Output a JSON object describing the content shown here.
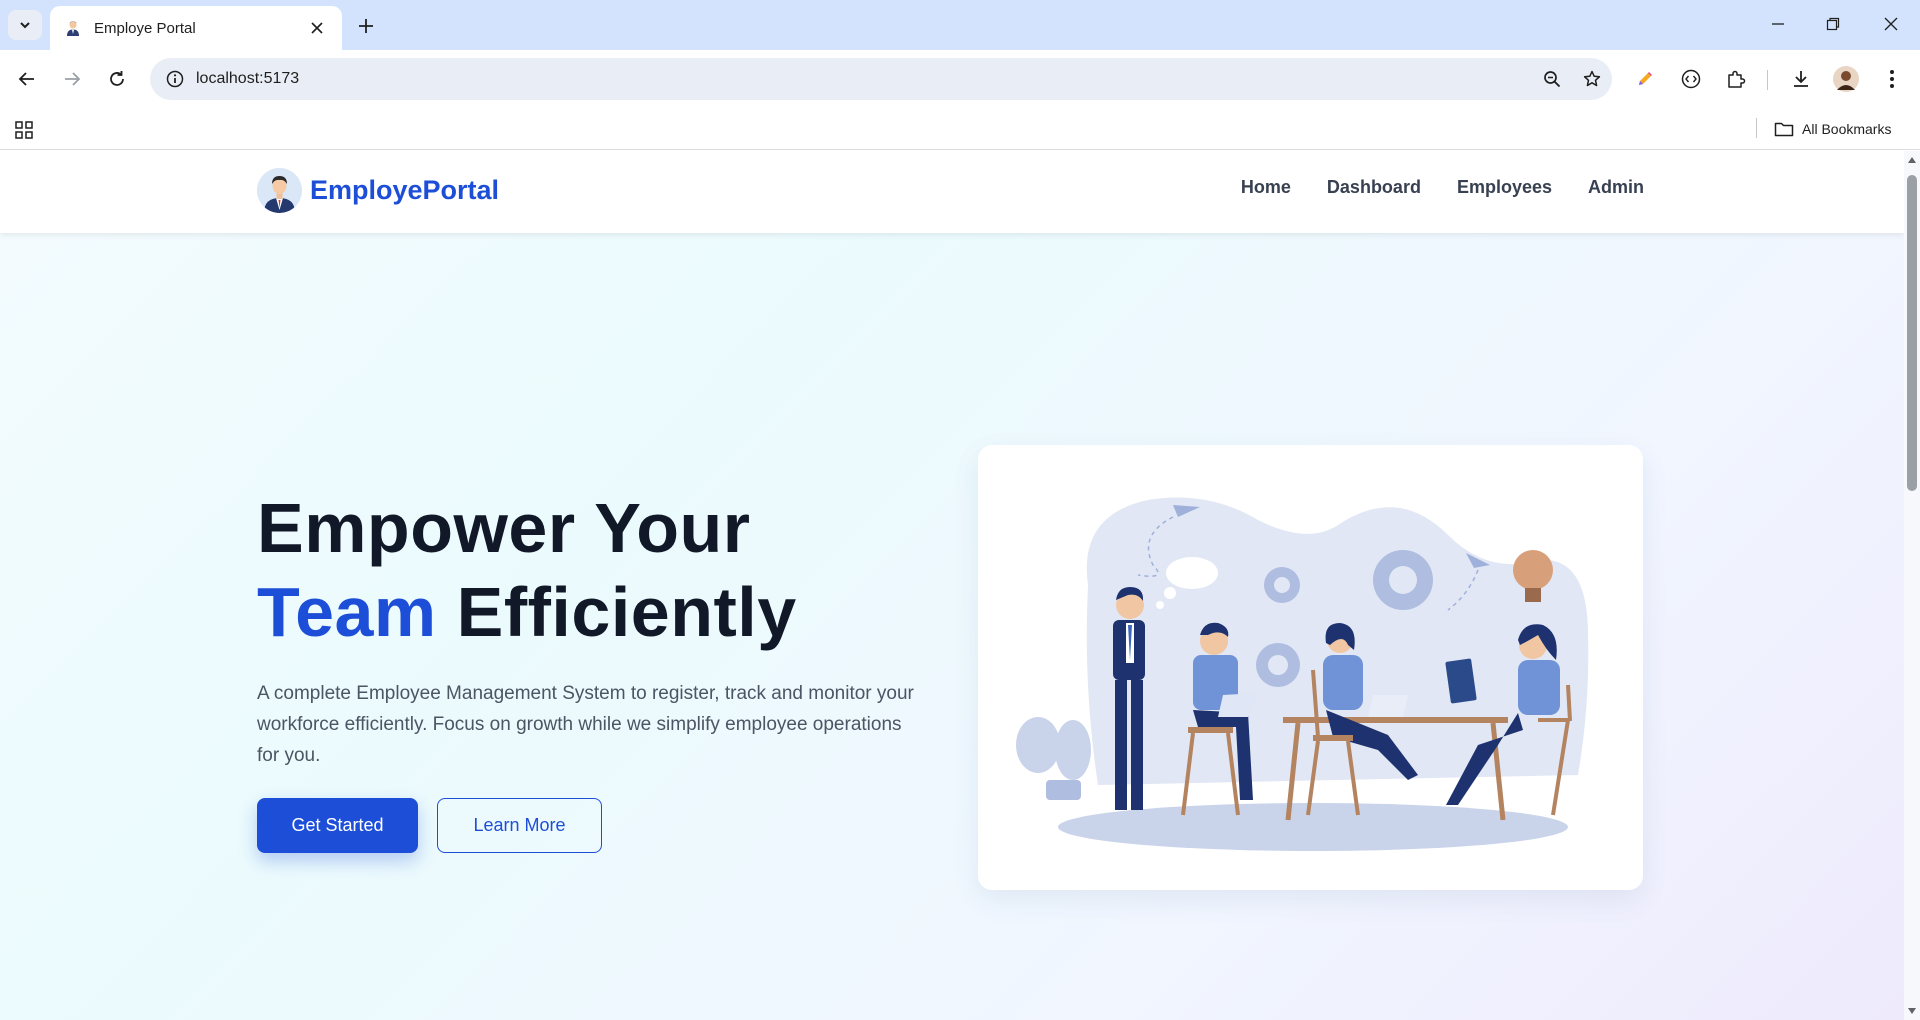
{
  "browser": {
    "tab_title": "Employe Portal",
    "url": "localhost:5173",
    "bookmarks_label": "All Bookmarks"
  },
  "site": {
    "brand": "EmployePortal",
    "nav": [
      "Home",
      "Dashboard",
      "Employees",
      "Admin"
    ]
  },
  "hero": {
    "title_line1": "Empower Your",
    "title_accent": "Team",
    "title_rest": "Efficiently",
    "description": "A complete Employee Management System to register, track and monitor your workforce efficiently. Focus on growth while we simplify employee operations for you.",
    "primary_cta": "Get Started",
    "secondary_cta": "Learn More"
  },
  "colors": {
    "accent": "#1d4ed8",
    "heading": "#111827",
    "body_text": "#4b5563"
  },
  "icons": {
    "tab_search": "chevron-down-icon",
    "favicon": "person-avatar-icon",
    "tab_close": "close-icon",
    "new_tab": "plus-icon",
    "back": "arrow-left-icon",
    "forward": "arrow-right-icon",
    "reload": "reload-icon",
    "site_info": "info-icon",
    "zoom": "zoom-icon",
    "bookmark": "star-icon",
    "extensions": "puzzle-icon",
    "downloads": "download-icon",
    "menu": "kebab-menu-icon"
  }
}
